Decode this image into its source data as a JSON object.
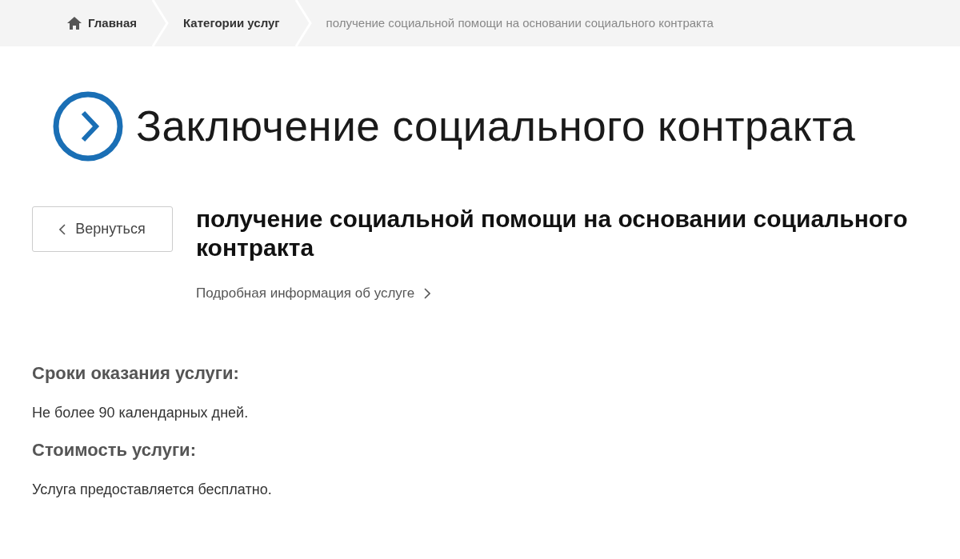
{
  "breadcrumbs": [
    {
      "label": "Главная",
      "kind": "home"
    },
    {
      "label": "Категории услуг",
      "kind": "link"
    },
    {
      "label": "получение социальной помощи на основании социального контракта",
      "kind": "current"
    }
  ],
  "title": "Заключение социального контракта",
  "back_button": "Вернуться",
  "service_name": "получение социальной помощи на основании социального контракта",
  "details_link": "Подробная информация об услуге",
  "sections": [
    {
      "heading": "Сроки оказания услуги:",
      "text": "Не более 90 календарных дней."
    },
    {
      "heading": "Стоимость услуги:",
      "text": "Услуга предоставляется бесплатно."
    }
  ]
}
